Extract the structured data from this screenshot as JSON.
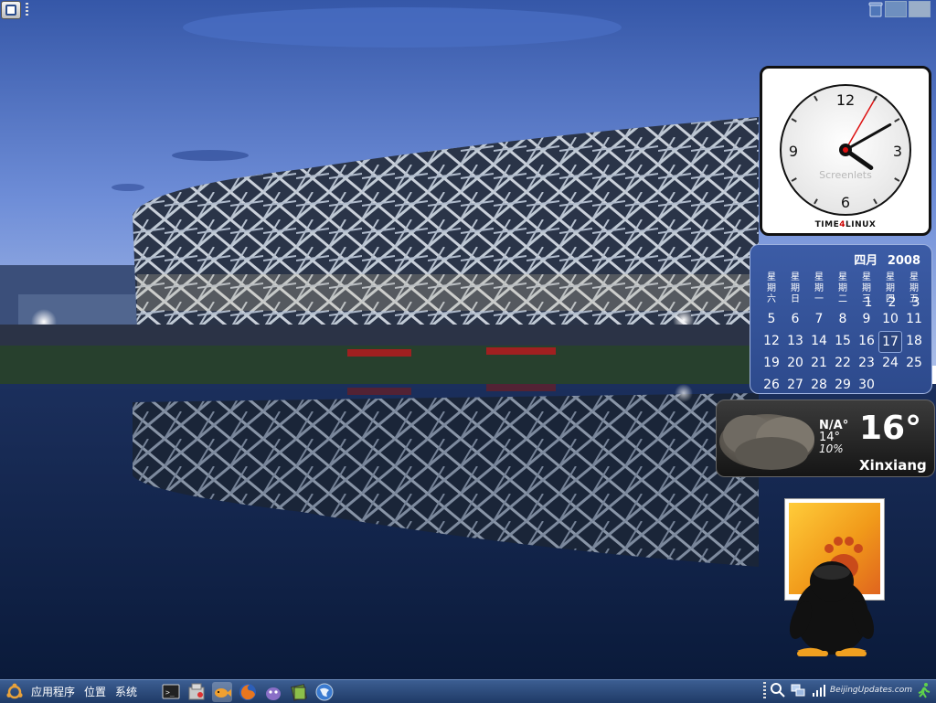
{
  "desktop": {
    "wallpaper": "beijing-national-stadium-dusk",
    "colors": {
      "sky_top": "#3d5fb5",
      "sky_horizon": "#8fa9e0",
      "water": "#0c2146",
      "panel": "#2a4a7c"
    }
  },
  "clock": {
    "numerals": [
      "12",
      "3",
      "6",
      "9"
    ],
    "watermark": "Screenlets",
    "brand": {
      "part1": "TIME",
      "accent": "4",
      "part2": "LINUX"
    },
    "time": {
      "hour": 4,
      "minute": 10,
      "second": 5
    }
  },
  "calendar": {
    "month": "四月",
    "year": "2008",
    "weekdays": [
      [
        "星",
        "期",
        "六"
      ],
      [
        "星",
        "期",
        "日"
      ],
      [
        "星",
        "期",
        "一"
      ],
      [
        "星",
        "期",
        "二"
      ],
      [
        "星",
        "期",
        "三"
      ],
      [
        "星",
        "期",
        "四"
      ],
      [
        "星",
        "期",
        "五"
      ]
    ],
    "overlap_days": [
      "1",
      "2",
      "3"
    ],
    "weeks": [
      [
        "5",
        "6",
        "7",
        "8",
        "9",
        "10",
        "11"
      ],
      [
        "12",
        "13",
        "14",
        "15",
        "16",
        "17",
        "18"
      ],
      [
        "19",
        "20",
        "21",
        "22",
        "23",
        "24",
        "25"
      ],
      [
        "26",
        "27",
        "28",
        "29",
        "30",
        "",
        ""
      ]
    ],
    "today": "17"
  },
  "weather": {
    "condition": "N/A°",
    "low": "14°",
    "humidity": "10%",
    "temperature": "16°",
    "city": "Xinxiang"
  },
  "panel": {
    "menu": [
      "应用程序",
      "位置",
      "系统"
    ],
    "launchers": [
      "terminal-icon",
      "package-manager-icon",
      "goldfish-icon",
      "firefox-icon",
      "pidgin-icon",
      "dictionary-icon",
      "globe-icon"
    ],
    "tray": [
      "search-icon",
      "network-icon",
      "volume-icon"
    ],
    "watermark": "BeijingUpdates.com"
  }
}
